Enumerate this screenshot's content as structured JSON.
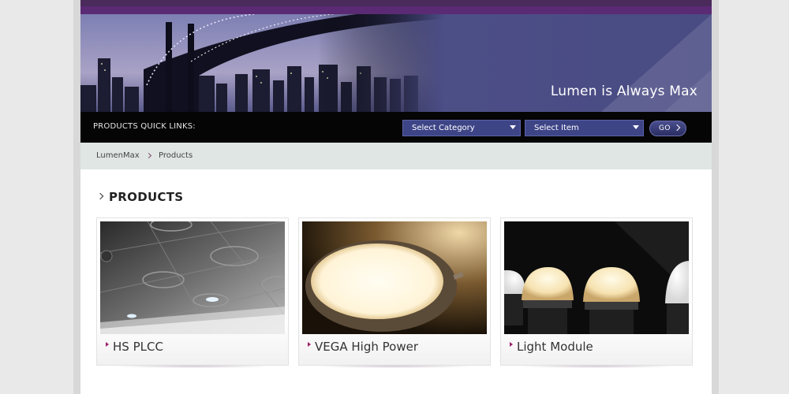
{
  "banner": {
    "tagline": "Lumen is Always Max"
  },
  "quick_links": {
    "label": "PRODUCTS QUICK LINKS:",
    "category_select": "Select Category",
    "item_select": "Select Item",
    "go_label": "GO"
  },
  "breadcrumb": {
    "items": [
      "LumenMax",
      "Products"
    ]
  },
  "section": {
    "heading": "PRODUCTS"
  },
  "products": [
    {
      "title": "HS PLCC"
    },
    {
      "title": "VEGA High Power"
    },
    {
      "title": "Light Module"
    }
  ],
  "colors": {
    "brand_purple": "#5b2a74",
    "banner_blue": "#494b83",
    "select_blue": "#3e4587",
    "bullet_magenta": "#9b1f6b"
  }
}
